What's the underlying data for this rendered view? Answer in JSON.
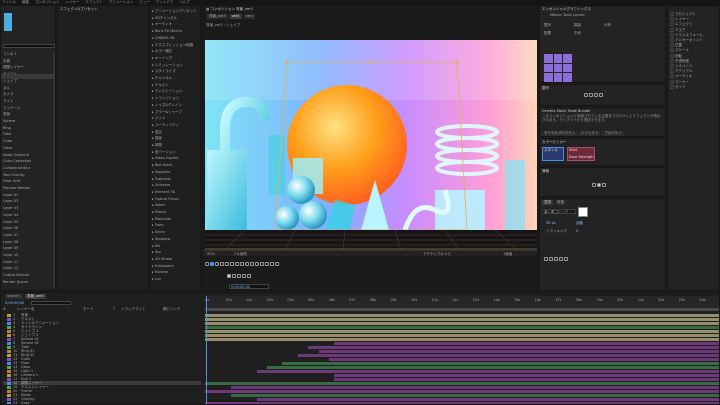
{
  "menubar": {
    "items": [
      "ファイル",
      "編集",
      "コンポジション",
      "レイヤー",
      "エフェクト",
      "アニメーション",
      "ビュー",
      "ウィンドウ",
      "ヘルプ"
    ]
  },
  "project": {
    "items": [
      "コンポ 1",
      "平面",
      "調整レイヤー",
      "テキスト",
      "シェイプ",
      "ヌル",
      "カメラ",
      "ライト",
      "フッテージ",
      "背景",
      "Sphere",
      "Ring",
      "Tube",
      "Cube",
      "Glass",
      "Noise Gradient",
      "Color Correction",
      "Compound Blur",
      "Text Overlay",
      "Floor Grid",
      "Preview Render",
      "Layer 01",
      "Layer 02",
      "Layer 03",
      "Layer 04",
      "Layer 05",
      "Layer 06",
      "Layer 07",
      "Layer 08",
      "Layer 09",
      "Layer 10",
      "Layer 11",
      "Layer 12",
      "Output Module",
      "Render Queue"
    ]
  },
  "effects": {
    "items": [
      "エフェクト&プリセット",
      "アニメーションプリセット",
      "3Dチャンネル",
      "オーディオ",
      "Boris FX Mocha",
      "CINEMA 4D",
      "エクスプレッション制御",
      "カラー補正",
      "キーイング",
      "シミュレーション",
      "スタイライズ",
      "チャンネル",
      "テキスト",
      "ディストーション",
      "トランジション",
      "ノイズ&グレイン",
      "ブラー&シャープ",
      "マット",
      "ユーティリティ",
      "遠近",
      "描画",
      "時間",
      "旧バージョン",
      "Video Copilot",
      "Red Giant",
      "Sapphire",
      "Trapcode",
      "Universe",
      "Element 3D",
      "Optical Flares",
      "Saber",
      "Plexus",
      "Particular",
      "Form",
      "Shine",
      "Starglow",
      "Mir",
      "Tao",
      "3D Stroke",
      "Echospace",
      "Horizon",
      "Lux"
    ]
  },
  "viewer": {
    "title": "コンポジション 背景_ver3",
    "tabs": [
      "背景_ver3",
      "ver2",
      "ver1"
    ],
    "crumb": "背景_ver3 › シェイプ",
    "zoom": "50%",
    "quality": "フル画質",
    "camera": "アクティブカメラ",
    "views": "1画面",
    "time": "0;00;00;00"
  },
  "essential": {
    "title": "エッセンシャルグラフィックス",
    "choose": "Motion Tools Layout",
    "buttons": [
      "整列",
      "配置",
      "複製",
      "中央",
      "分布"
    ]
  },
  "align": {
    "title": "整列"
  },
  "libraries": {
    "title": "Cinema Stock Trade Bundle",
    "body": "このコンポジションに適用されている主要なプロパティとエフェクトが表示されます。ライブラリから追加できます。",
    "tabs": [
      "すべてのプロパティ",
      "エフェクト",
      "プロパティ"
    ]
  },
  "color": {
    "title": "カラーピッカー",
    "labels": [
      "スタイル",
      "Start",
      "Hue",
      "Scale",
      "Ease Strength"
    ]
  },
  "info": {
    "title": "情報"
  },
  "character": {
    "title": "文字",
    "font": "源ノ角ゴシック",
    "size": "36 px",
    "leading": "自動",
    "tracking": "0",
    "labels": [
      "文字",
      "段落",
      "トラッキング"
    ]
  },
  "timeline": {
    "tabs": [
      "Scene 1",
      "背景_ver3"
    ],
    "time": "0;00;00;00",
    "columns": [
      "#",
      "レイヤー名",
      "モード",
      "T",
      "トラックマット",
      "親とリンク"
    ],
    "layers": [
      "背景",
      "テキスト",
      "ドットのアニメーション",
      "ガイドライン",
      "シェイプ 1",
      "シェイプ 2",
      "Sphere 01",
      "Sphere 02",
      "Tube",
      "Ring 01",
      "Ring 02",
      "Cube",
      "Floor",
      "Glass",
      "Light 1",
      "Camera 1",
      "Null 1",
      "調整レイヤー",
      "テキストレイヤー",
      "Frame",
      "Noise",
      "Overlay",
      "Grad"
    ],
    "ruler": [
      "0s",
      "01s",
      "02s",
      "03s",
      "04s",
      "05s",
      "06s",
      "07s",
      "08s",
      "09s",
      "10s",
      "11s",
      "12s",
      "13s",
      "14s",
      "15s",
      "16s",
      "17s",
      "18s",
      "19s",
      "20s",
      "21s",
      "22s",
      "23s",
      "24s",
      "25s"
    ]
  },
  "colors": {
    "accent": "#4a8fe8",
    "yellow_track": "#a9a27a",
    "purple_track": "#7d3e8a",
    "green_track": "#3c7a4c",
    "label_purple": "#8c6ed8"
  },
  "right": {
    "items": [
      "プロジェクト",
      "レイヤー",
      "エフェクト",
      "マスク",
      "トランスフォーム",
      "アンカーポイント",
      "位置",
      "スケール",
      "回転",
      "不透明度",
      "ジオメトリ",
      "マテリアル",
      "オーディオ",
      "マーカー",
      "ガイド"
    ]
  }
}
